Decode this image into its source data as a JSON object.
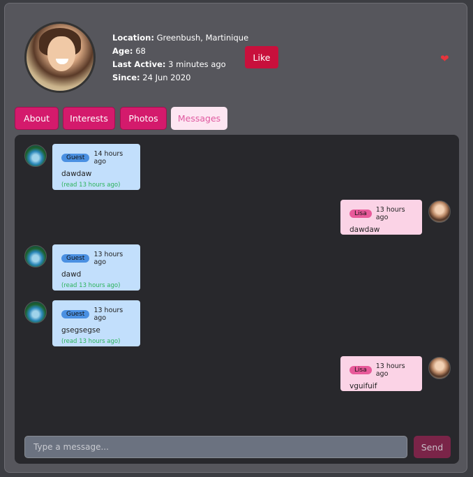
{
  "profile": {
    "location_label": "Location:",
    "location": "Greenbush, Martinique",
    "age_label": "Age:",
    "age": "68",
    "last_active_label": "Last Active:",
    "last_active": "3 minutes ago",
    "since_label": "Since:",
    "since": "24 Jun 2020",
    "like_label": "Like",
    "favorite_icon": "heart-icon"
  },
  "tabs": [
    {
      "label": "About"
    },
    {
      "label": "Interests"
    },
    {
      "label": "Photos"
    },
    {
      "label": "Messages",
      "active": true
    }
  ],
  "messages": [
    {
      "sender": "Guest",
      "time": "14 hours ago",
      "text": "dawdaw",
      "read": "(read 13 hours ago)"
    },
    {
      "sender": "Lisa",
      "time": "13 hours ago",
      "text": "dawdaw"
    },
    {
      "sender": "Guest",
      "time": "13 hours ago",
      "text": "dawd",
      "read": "(read 13 hours ago)"
    },
    {
      "sender": "Guest",
      "time": "13 hours ago",
      "text": "gsegsegse",
      "read": "(read 13 hours ago)"
    },
    {
      "sender": "Lisa",
      "time": "13 hours ago",
      "text": "vguifuif"
    }
  ],
  "composer": {
    "placeholder": "Type a message...",
    "send_label": "Send"
  },
  "colors": {
    "accent": "#d41a6c",
    "like": "#c8103c",
    "guest_bubble": "#c2dffc",
    "lisa_bubble": "#fbd3e6"
  }
}
